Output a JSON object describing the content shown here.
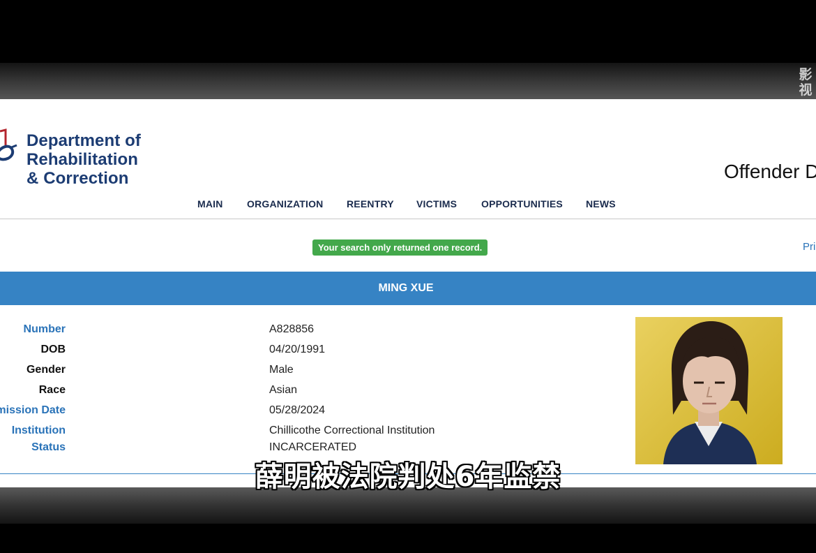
{
  "watermark": [
    "影",
    "视"
  ],
  "header": {
    "logo_lines": [
      "Department of",
      "Rehabilitation",
      "& Correction"
    ],
    "site_title": "Offender D"
  },
  "nav": {
    "items": [
      "MAIN",
      "ORGANIZATION",
      "REENTRY",
      "VICTIMS",
      "OPPORTUNITIES",
      "NEWS"
    ]
  },
  "notice": "Your search only returned one record.",
  "print_link": "Pri",
  "offender": {
    "name": "MING XUE",
    "fields": [
      {
        "label": "Number",
        "value": "A828856",
        "link": true
      },
      {
        "label": "DOB",
        "value": "04/20/1991",
        "link": false
      },
      {
        "label": "Gender",
        "value": "Male",
        "link": false
      },
      {
        "label": "Race",
        "value": "Asian",
        "link": false
      },
      {
        "label": "Admission Date",
        "value": "05/28/2024",
        "link": true
      },
      {
        "label": "Institution",
        "value": "Chillicothe Correctional Institution",
        "link": true
      },
      {
        "label": "Status",
        "value": "INCARCERATED",
        "link": true
      }
    ]
  },
  "subtitle": "薛明被法院判处6年监禁",
  "colors": {
    "brand_navy": "#1c3c73",
    "band_blue": "#3683c4",
    "link_blue": "#2a73b8",
    "notice_green": "#43a84b",
    "photo_yellow": "#e2c12a"
  }
}
